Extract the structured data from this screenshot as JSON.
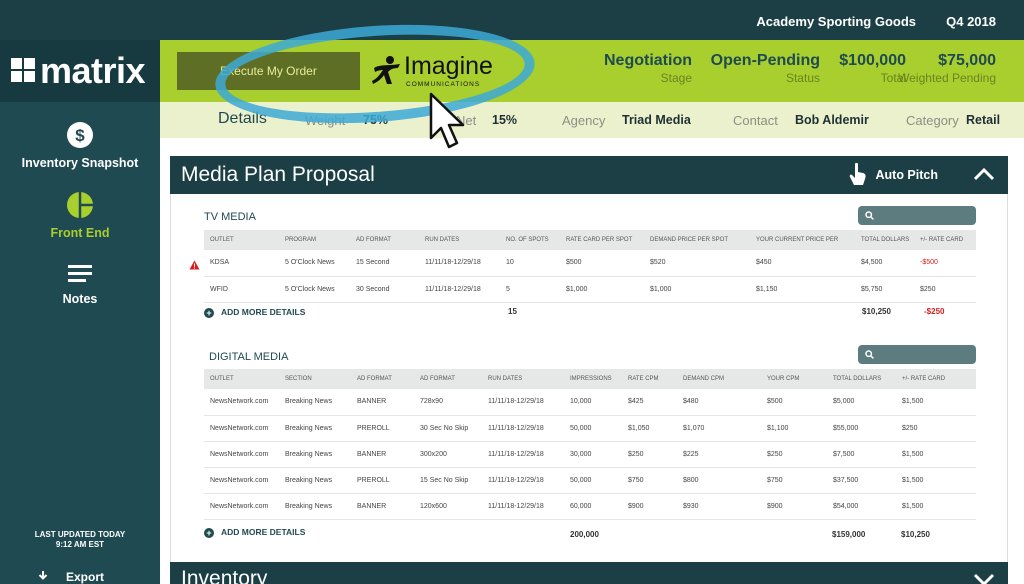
{
  "topbar": {
    "client": "Academy Sporting Goods",
    "quarter": "Q4 2018"
  },
  "logo": {
    "text": "matrix"
  },
  "sidebar": {
    "items": [
      {
        "label": "Inventory Snapshot",
        "icon": "dollar-icon"
      },
      {
        "label": "Front End",
        "icon": "pie-chart-icon",
        "active": true
      },
      {
        "label": "Notes",
        "icon": "notes-icon"
      }
    ],
    "updated": "LAST UPDATED TODAY",
    "updated_time": "9:12 AM EST",
    "export_label": "Export"
  },
  "header": {
    "execute_label": "Execute My Order",
    "partner_logo_word": "Imagine",
    "partner_logo_sub": "COMMUNICATIONS",
    "stats": [
      {
        "value": "Negotiation",
        "label": "Stage"
      },
      {
        "value": "Open-Pending",
        "label": "Status"
      },
      {
        "value": "$100,000",
        "label": "Total"
      },
      {
        "value": "$75,000",
        "label": "Weighted Pending"
      }
    ]
  },
  "details": {
    "title": "Details",
    "weight_label": "Weight",
    "weight_value": "75%",
    "net_label": "Net",
    "net_value": "15%",
    "agency_label": "Agency",
    "agency_value": "Triad Media",
    "contact_label": "Contact",
    "contact_value": "Bob Aldemir",
    "category_label": "Category",
    "category_value": "Retail"
  },
  "plan": {
    "title": "Media Plan Proposal",
    "autopitch_label": "Auto Pitch",
    "tv": {
      "title": "TV MEDIA",
      "columns": [
        "OUTLET",
        "PROGRAM",
        "AD FORMAT",
        "RUN DATES",
        "NO. OF SPOTS",
        "RATE CARD PER SPOT",
        "DEMAND PRICE PER SPOT",
        "YOUR CURRENT PRICE PER",
        "TOTAL DOLLARS",
        "+/- RATE CARD"
      ],
      "rows": [
        [
          "KDSA",
          "5 O'Clock News",
          "15 Second",
          "11/11/18-12/29/18",
          "10",
          "$500",
          "$520",
          "$450",
          "$4,500",
          "-$500"
        ],
        [
          "WFID",
          "5 O'Clock News",
          "30 Second",
          "11/11/18-12/29/18",
          "5",
          "$1,000",
          "$1,000",
          "$1,150",
          "$5,750",
          "$250"
        ]
      ],
      "add_more": "ADD MORE DETAILS",
      "total_spots": "15",
      "total_dollars": "$10,250",
      "total_rate": "-$250"
    },
    "digital": {
      "title": "DIGITAL MEDIA",
      "columns": [
        "OUTLET",
        "SECTION",
        "AD FORMAT",
        "AD FORMAT",
        "RUN DATES",
        "IMPRESSIONS",
        "RATE CPM",
        "DEMAND CPM",
        "YOUR CPM",
        "TOTAL DOLLARS",
        "+/- RATE CARD"
      ],
      "rows": [
        [
          "NewsNetwork.com",
          "Breaking News",
          "BANNER",
          "728x90",
          "11/11/18-12/29/18",
          "10,000",
          "$425",
          "$480",
          "$500",
          "$5,000",
          "$1,500"
        ],
        [
          "NewsNetwork.com",
          "Breaking News",
          "PREROLL",
          "30 Sec No Skip",
          "11/11/18-12/29/18",
          "50,000",
          "$1,050",
          "$1,070",
          "$1,100",
          "$55,000",
          "$250"
        ],
        [
          "NewsNetwork.com",
          "Breaking News",
          "BANNER",
          "300x200",
          "11/11/18-12/29/18",
          "30,000",
          "$250",
          "$225",
          "$250",
          "$7,500",
          "$1,500"
        ],
        [
          "NewsNetwork.com",
          "Breaking News",
          "PREROLL",
          "15 Sec No Skip",
          "11/11/18-12/29/18",
          "50,000",
          "$750",
          "$800",
          "$750",
          "$37,500",
          "$1,500"
        ],
        [
          "NewsNetwork.com",
          "Breaking News",
          "BANNER",
          "120x600",
          "11/11/18-12/29/18",
          "60,000",
          "$900",
          "$930",
          "$900",
          "$54,000",
          "$1,500"
        ]
      ],
      "add_more": "ADD MORE DETAILS",
      "total_impressions": "200,000",
      "total_dollars": "$159,000",
      "total_rate": "$10,250"
    }
  },
  "inventory": {
    "title": "Inventory"
  },
  "colors": {
    "accent": "#a8cf2e",
    "dark": "#1b3f45",
    "sidebar": "#1f4a51",
    "negative": "#d42020",
    "highlight": "#3da9d6"
  }
}
